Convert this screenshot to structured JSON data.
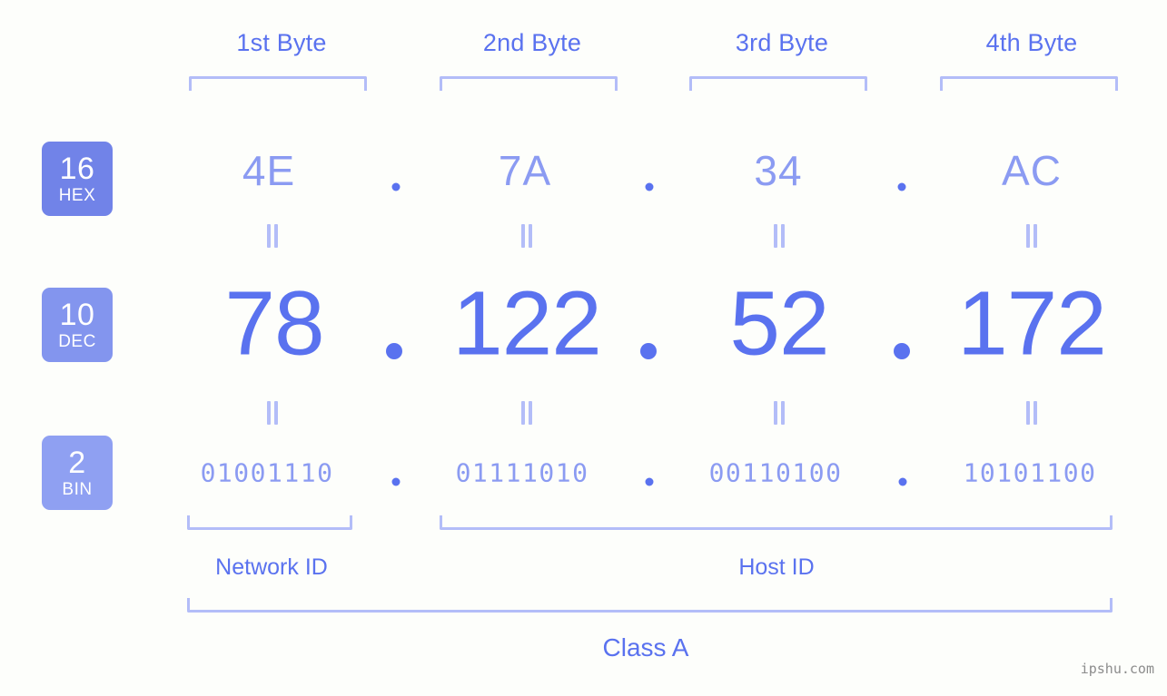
{
  "background_color": "#fdfefb",
  "accent": {
    "primary": "#5a72ef",
    "light": "#8b9bf2",
    "bracket": "#b3bdf8"
  },
  "header": {
    "byte_labels": [
      "1st Byte",
      "2nd Byte",
      "3rd Byte",
      "4th Byte"
    ]
  },
  "radix_badges": [
    {
      "number": "16",
      "name": "HEX",
      "color": "#7183e8"
    },
    {
      "number": "10",
      "name": "DEC",
      "color": "#8395ee"
    },
    {
      "number": "2",
      "name": "BIN",
      "color": "#8fa0f2"
    }
  ],
  "separator": ".",
  "rows": {
    "hex": {
      "radix": "16",
      "label": "HEX",
      "values": [
        "4E",
        "7A",
        "34",
        "AC"
      ]
    },
    "dec": {
      "radix": "10",
      "label": "DEC",
      "values": [
        "78",
        "122",
        "52",
        "172"
      ]
    },
    "bin": {
      "radix": "2",
      "label": "BIN",
      "values": [
        "01001110",
        "01111010",
        "00110100",
        "10101100"
      ]
    }
  },
  "equals_mark": "||",
  "ip_address": {
    "dec_dotted": "78.122.52.172",
    "hex_dotted": "4E.7A.34.AC",
    "bin_dotted": "01001110.01111010.00110100.10101100"
  },
  "footer": {
    "network_id_label": "Network ID",
    "host_id_label": "Host ID",
    "class_label": "Class A",
    "watermark": "ipshu.com"
  }
}
